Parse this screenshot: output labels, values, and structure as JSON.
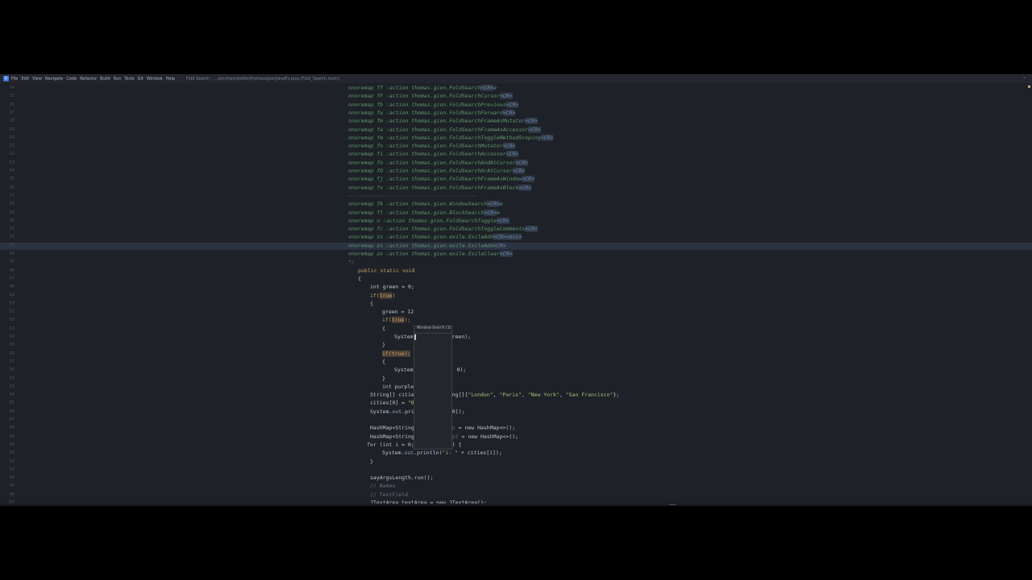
{
  "app": {
    "logo": "V",
    "menu": [
      "File",
      "Edit",
      "View",
      "Navigate",
      "Code",
      "Refactor",
      "Build",
      "Run",
      "Tools",
      "Git",
      "Window",
      "Help"
    ],
    "title": "Fold Search - .../src/main/kotlin/thomas/gion/JavaFx.java [Fold_Search.main]",
    "minimize": "–"
  },
  "editor": {
    "vim_lines": [
      {
        "n": "14",
        "text": "nnoremap ff :action thomas.gion.FoldSearch",
        "cr": "<CR>",
        "tail": "e"
      },
      {
        "n": "15",
        "text": "nnoremap fF :action thomas.gion.FoldSearchCursor",
        "cr": "<CR>",
        "tail": ""
      },
      {
        "n": "16",
        "text": "nnoremap fb :action thomas.gion.FoldSearchPrevious",
        "cr": "<CR>",
        "tail": ""
      },
      {
        "n": "17",
        "text": "nnoremap fw :action thomas.gion.FoldSearchForward",
        "cr": "<CR>",
        "tail": ""
      },
      {
        "n": "18",
        "text": "nnoremap fm :action thomas.gion.FoldSearchFrameAsMutator",
        "cr": "<CR>",
        "tail": ""
      },
      {
        "n": "19",
        "text": "nnoremap fa :action thomas.gion.FoldSearchFrameAsAccessor",
        "cr": "<CR>",
        "tail": ""
      },
      {
        "n": "20",
        "text": "nnoremap fm :action thomas.gion.FoldSearchToggleMethodScoping",
        "cr": "<CR>",
        "tail": ""
      },
      {
        "n": "21",
        "text": "nnoremap fn :action thomas.gion.FoldSearchMutator",
        "cr": "<CR>",
        "tail": ""
      },
      {
        "n": "22",
        "text": "nnoremap fi :action thomas.gion.FoldSearchAccessor",
        "cr": "<CR>",
        "tail": ""
      },
      {
        "n": "23",
        "text": "nnoremap fo :action thomas.gion.FoldSearchAndAtCursor",
        "cr": "<CR>",
        "tail": ""
      },
      {
        "n": "24",
        "text": "nnoremap fO :action thomas.gion.FoldSearchOrAtCursor",
        "cr": "<CR>",
        "tail": ""
      },
      {
        "n": "25",
        "text": "nnoremap fj :action thomas.gion.FoldSearchFrameAsWindow",
        "cr": "<CR>",
        "tail": ""
      },
      {
        "n": "26",
        "text": "nnoremap fv :action thomas.gion.FoldSearchFrameAsBlock",
        "cr": "<CR>",
        "tail": ""
      },
      {
        "n": "28",
        "text": "nnoremap fk :action thomas.gion.WindowSearch",
        "cr": "<CR>",
        "tail": "e"
      },
      {
        "n": "29",
        "text": "nnoremap fl :action thomas.gion.BlockSearch",
        "cr": "<CR>",
        "tail": "e"
      },
      {
        "n": "30",
        "text": "nnoremap n :action thomas.gion.FoldSearchToggle",
        "cr": "<CR>",
        "tail": ""
      },
      {
        "n": "31",
        "text": "nnoremap fc :action thomas.gion.FoldSearchToggleComments",
        "cr": "<CR>",
        "tail": ""
      },
      {
        "n": "32",
        "text": "vnoremap zs :action thomas.gion.exile.ExileAdd",
        "cr": "<CR><esc>",
        "tail": ""
      },
      {
        "n": "33",
        "text": "nnoremap zs :action thomas.gion.exile.ExileAdd",
        "cr": "<CR>",
        "tail": ""
      },
      {
        "n": "34",
        "text": "nnoremap zx :action thomas.gion.exile.ExileClear",
        "cr": "<CR>",
        "tail": ""
      }
    ],
    "comment_ln": "27",
    "end_comment": {
      "n": "35",
      "text": "*/"
    },
    "popup_title": "Window Search (1)",
    "java": {
      "l46": {
        "n": "46",
        "a": "public static void"
      },
      "l47": {
        "n": "47",
        "a": "{"
      },
      "l48": {
        "n": "48",
        "a": "int green = 0;"
      },
      "l49": {
        "n": "49",
        "a": "if(",
        "b": "true",
        "c": ")"
      },
      "l50": {
        "n": "50",
        "a": "{"
      },
      "l51": {
        "n": "51",
        "a": "green = 12"
      },
      "l52": {
        "n": "52",
        "a": "if(",
        "b": "true",
        "c": ");"
      },
      "l53": {
        "n": "53",
        "a": "{"
      },
      "l54": {
        "n": "54",
        "a": "System",
        "b": "reen);"
      },
      "l55": {
        "n": "55",
        "a": "}"
      },
      "l56": {
        "n": "56",
        "a": "if(",
        "b": "true",
        "c": ");"
      },
      "l57": {
        "n": "57",
        "a": "{"
      },
      "l58": {
        "n": "58",
        "a": "System",
        "b": "0);"
      },
      "l59": {
        "n": "59",
        "a": "}"
      },
      "l83": {
        "n": "83",
        "a": "int purple = 0;"
      },
      "l84": {
        "n": "84",
        "a": "String[] cities = new String[]{",
        "s1": "\"London\"",
        "s2": "\"Paris\"",
        "s3": "\"New York\"",
        "s4": "\"San Francisco\"",
        "z": "};"
      },
      "l85": {
        "n": "85",
        "a": "cities[0] = ",
        "s": "\"Berlin\"",
        "z": ";"
      },
      "l86": {
        "n": "86",
        "a": "System.",
        "f": "out",
        "b": ".println(cities[0]);"
      },
      "l87": {
        "n": "87"
      },
      "l88": {
        "n": "88",
        "a": "HashMap<String, String> ",
        "v": "map",
        "b": " = new HashMap<>();"
      },
      "l89": {
        "n": "89",
        "a": "HashMap<String, String> ",
        "v": "map2",
        "b": " = new HashMap<>();"
      },
      "l90": {
        "n": "90",
        "a": "for (int i = 0; i < 10; i++) {"
      },
      "l91": {
        "n": "91",
        "a": "System.",
        "f": "out",
        "b": ".println(",
        "s": "\"i: \"",
        "z": " + cities[i]);"
      },
      "l92": {
        "n": "92",
        "a": "}"
      },
      "l93": {
        "n": "93"
      },
      "l94": {
        "n": "94",
        "a": "sayArgsLength.run();"
      },
      "l95": {
        "n": "95",
        "a": "// Names"
      },
      "l96": {
        "n": "96",
        "a": "// TextField"
      },
      "l97": {
        "n": "97",
        "a": "JTextArea textArea = new JTextArea();"
      }
    },
    "colors": {
      "background": "#1e2127",
      "vim_text": "#5f9a6e",
      "keyword": "#c7a46a",
      "string": "#a5c27a"
    }
  }
}
